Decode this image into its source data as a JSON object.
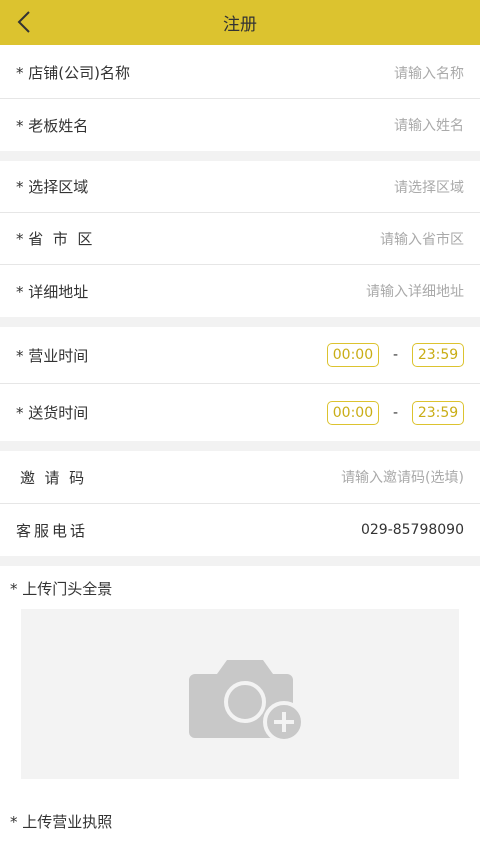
{
  "header": {
    "title": "注册",
    "back_icon": "back-chevron-icon"
  },
  "store_info": [
    {
      "label": "* 店铺(公司)名称",
      "placeholder": "请输入名称"
    },
    {
      "label": "* 老板姓名",
      "placeholder": "请输入姓名"
    }
  ],
  "address": [
    {
      "label": "* 选择区域",
      "placeholder": "请选择区域"
    },
    {
      "label": "* 省  市  区",
      "placeholder": "请输入省市区"
    },
    {
      "label": "* 详细地址",
      "placeholder": "请输入详细地址"
    }
  ],
  "hours": [
    {
      "label": "* 营业时间",
      "start": "00:00",
      "end": "23:59"
    },
    {
      "label": "* 送货时间",
      "start": "00:00",
      "end": "23:59"
    }
  ],
  "time_separator": "-",
  "invite": {
    "label": "邀  请  码",
    "placeholder": "请输入邀请码(选填)"
  },
  "service": {
    "label": "客服电话",
    "phone": "029-85798090"
  },
  "upload": {
    "title": "* 上传门头全景",
    "icon": "camera-add-icon",
    "next_title": "* 上传营业执照"
  },
  "colors": {
    "accent": "#dcc32f"
  }
}
